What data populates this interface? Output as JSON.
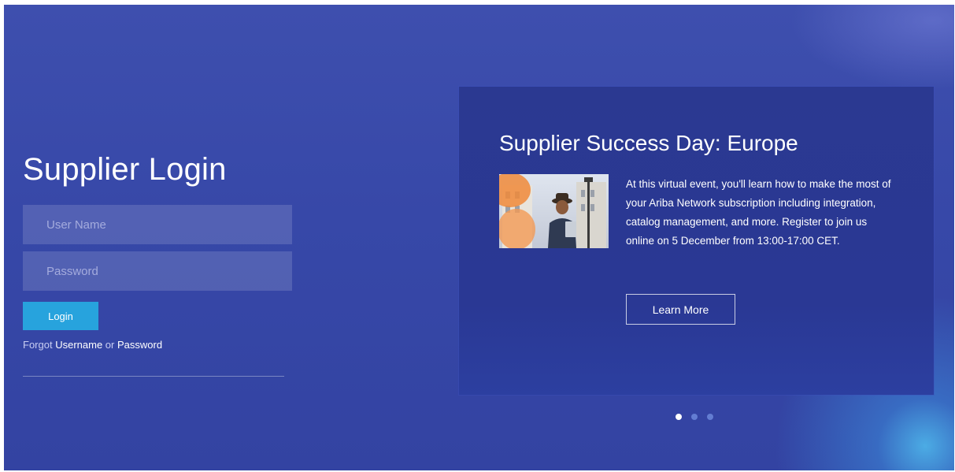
{
  "login": {
    "title": "Supplier Login",
    "username_placeholder": "User Name",
    "password_placeholder": "Password",
    "login_label": "Login",
    "forgot_prefix": "Forgot",
    "forgot_username": "Username",
    "forgot_or": "or",
    "forgot_password": "Password"
  },
  "promo": {
    "title": "Supplier Success Day: Europe",
    "body": "At this virtual event, you'll learn how to make the most of your Ariba Network subscription including integration, catalog management, and more. Register to join us online on 5 December from 13:00-17:00 CET.",
    "learn_more_label": "Learn More",
    "image_icon": "man-with-tablet-photo"
  },
  "carousel": {
    "count": 3,
    "active_index": 0
  },
  "colors": {
    "background": "#3748a8",
    "panel": "#2b3991",
    "login_button": "#27a3dd"
  }
}
